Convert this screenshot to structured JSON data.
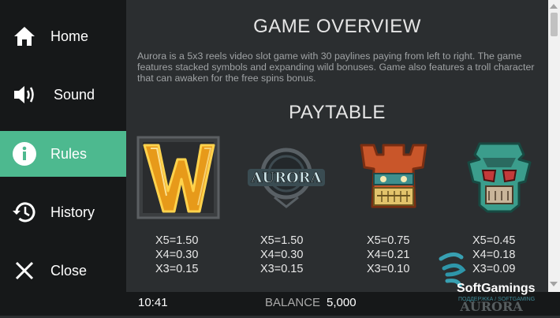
{
  "nav": {
    "items": [
      {
        "label": "Home",
        "icon": "home-icon"
      },
      {
        "label": "Sound",
        "icon": "sound-icon"
      },
      {
        "label": "Rules",
        "icon": "info-icon"
      },
      {
        "label": "History",
        "icon": "history-icon"
      },
      {
        "label": "Close",
        "icon": "close-icon"
      }
    ],
    "active": "Rules",
    "active_color": "#4db98f"
  },
  "content": {
    "overview_title": "GAME OVERVIEW",
    "overview_text": "Aurora is a 5x3 reels video slot game with 30 paylines paying from left to right. The game features stacked symbols and expanding wild bonuses. Game also features a troll character that can awaken for the free spins bonus.",
    "paytable_title": "PAYTABLE",
    "symbols": [
      {
        "icon": "wild-w-symbol-icon",
        "payouts": [
          "X5=1.50",
          "X4=0.30",
          "X3=0.15"
        ]
      },
      {
        "icon": "aurora-logo-symbol-icon",
        "logo_text": "AURORA",
        "payouts": [
          "X5=1.50",
          "X4=0.30",
          "X3=0.15"
        ]
      },
      {
        "icon": "orange-totem-mask-icon",
        "payouts": [
          "X5=0.75",
          "X4=0.21",
          "X3=0.10"
        ]
      },
      {
        "icon": "green-totem-mask-icon",
        "payouts": [
          "X5=0.45",
          "X4=0.18",
          "X3=0.09"
        ]
      }
    ]
  },
  "status": {
    "time": "10:41",
    "balance_label": "BALANCE",
    "balance_value": "5,000"
  },
  "branding": {
    "provider": "SoftGamings",
    "game_logo": "AURORA",
    "watermark_text": "ПОДДЕРЖКА / SOFTGAMING"
  }
}
